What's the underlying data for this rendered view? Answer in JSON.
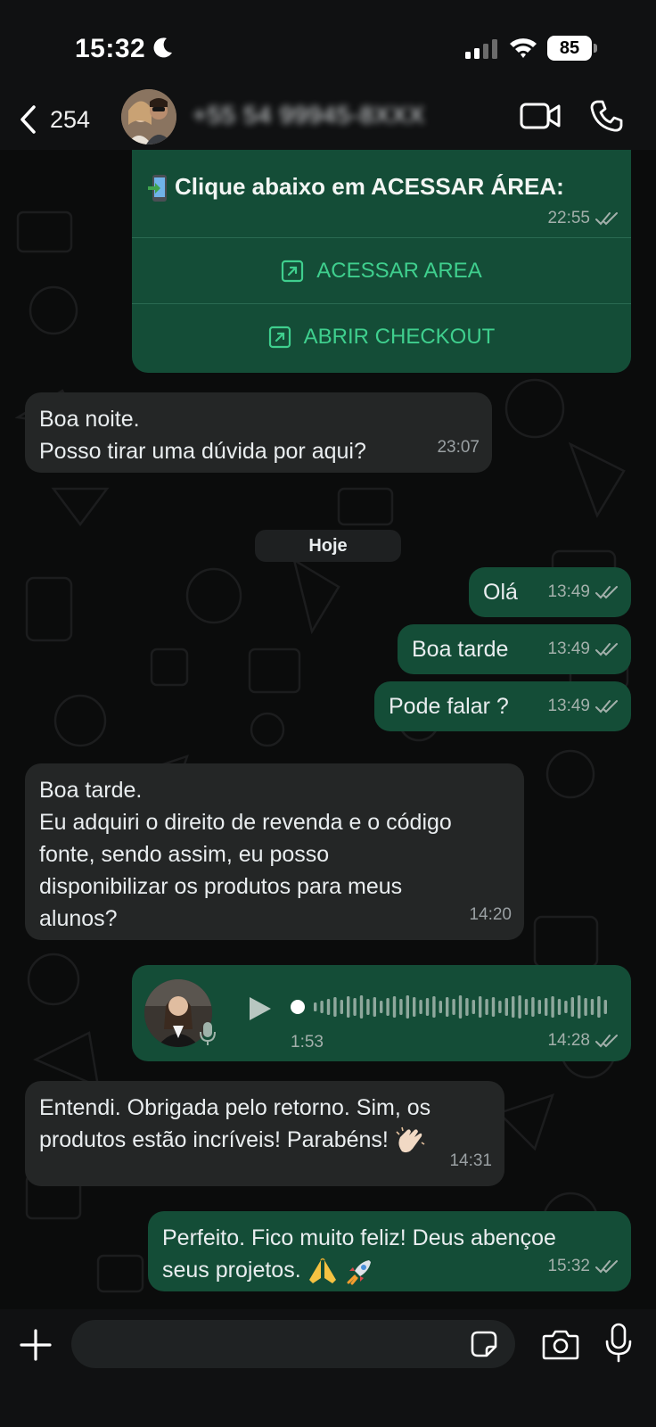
{
  "status_bar": {
    "time": "15:32",
    "battery": "85",
    "icons": [
      "moon-icon",
      "signal-icon",
      "wifi-icon",
      "battery-icon"
    ]
  },
  "header": {
    "back_count": "254",
    "contact_name": "+55 54 99945-8XXX",
    "icons": [
      "back-icon",
      "video-call-icon",
      "voice-call-icon"
    ]
  },
  "card": {
    "title": "Clique abaixo em ACESSAR ÁREA:",
    "time": "22:55",
    "action_1": "ACESSAR AREA",
    "action_2": "ABRIR CHECKOUT"
  },
  "messages": {
    "m1": {
      "line1": "Boa noite.",
      "line2": "Posso tirar uma dúvida por aqui?",
      "time": "23:07"
    },
    "date_separator": "Hoje",
    "m2": {
      "text": "Olá",
      "time": "13:49"
    },
    "m3": {
      "text": "Boa tarde",
      "time": "13:49"
    },
    "m4": {
      "text": "Pode falar ?",
      "time": "13:49"
    },
    "m5": {
      "line1": "Boa tarde.",
      "line2": "Eu adquiri o direito de revenda e o código",
      "line3": "fonte, sendo assim, eu posso",
      "line4": "disponibilizar os produtos para meus",
      "line5": "alunos?",
      "time": "14:20"
    },
    "voice": {
      "duration": "1:53",
      "time": "14:28",
      "progress": 0
    },
    "m6": {
      "line1": "Entendi. Obrigada pelo retorno. Sim, os",
      "line2": "produtos estão incríveis! Parabéns!",
      "time": "14:31"
    },
    "m7": {
      "line1": "Perfeito. Fico muito feliz! Deus abençoe",
      "line2": "seus projetos.",
      "time": "15:32"
    }
  },
  "input_bar": {
    "placeholder": "",
    "icons": [
      "plus-icon",
      "sticker-icon",
      "camera-icon",
      "mic-icon"
    ]
  },
  "colors": {
    "outgoing_bubble": "#144d37",
    "incoming_bubble": "#242626",
    "accent_green": "#3fcf8e",
    "background": "#0b0c0c"
  }
}
